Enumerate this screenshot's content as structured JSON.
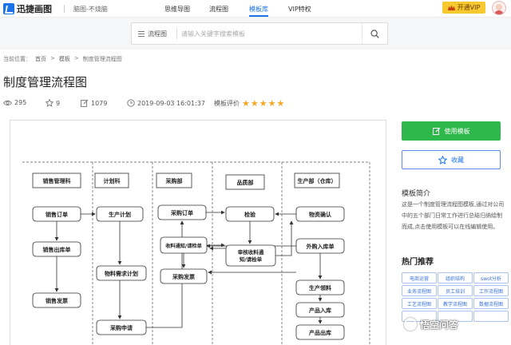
{
  "brand": {
    "name": "迅捷画图",
    "slogan": "脑图-不烧脑"
  },
  "nav": [
    {
      "label": "思维导图"
    },
    {
      "label": "流程图"
    },
    {
      "label": "模板库"
    },
    {
      "label": "VIP特权"
    }
  ],
  "vip_button": "开通VIP",
  "search": {
    "category": "流程图",
    "placeholder": "请输入关键字搜索模板"
  },
  "breadcrumb": {
    "prefix": "当前位置：",
    "items": [
      "首页",
      "模板",
      "制度管理流程图"
    ],
    "separator": ">"
  },
  "title": "制度管理流程图",
  "meta": {
    "views": "295",
    "stars": "9",
    "edits": "1079",
    "date": "2019-09-03 16:01:37",
    "rating_label": "模板评价",
    "rating": 5
  },
  "flowchart": {
    "lanes": [
      "销售管理科",
      "计划科",
      "采购部",
      "品质部",
      "生产部（仓库）"
    ],
    "nodes": [
      "销售订单",
      "销售出库单",
      "销售发票",
      "生产计划",
      "物料需求计划",
      "采购申请",
      "采购订单",
      "收料通知/请检单",
      "采购发票",
      "检验",
      "审核收料通知/请检单",
      "物资确认",
      "外购入库单",
      "生产领料",
      "产品入库",
      "产品出库"
    ]
  },
  "sidebar": {
    "use_button": "使用模板",
    "fav_button": "收藏",
    "intro_heading": "模板简介",
    "intro_text": "这是一个制度管理流程图模板,通过对公司中的五个部门日常工作进行总结归纳绘制而成,点击使用模板可以在线编辑使用。",
    "hot_heading": "热门推荐",
    "tags": [
      "电商运营",
      "组织结构",
      "swot分析",
      "业务流程图",
      "员工培训",
      "工作流程图",
      "工艺流程图",
      "教学流程图",
      "数据流程图",
      "",
      "",
      ""
    ]
  },
  "watermark": "悟空问答",
  "colors": {
    "accent": "#1a73e8",
    "vip": "#f8c830",
    "use_button": "#2eb84b",
    "star": "#f5a623"
  }
}
